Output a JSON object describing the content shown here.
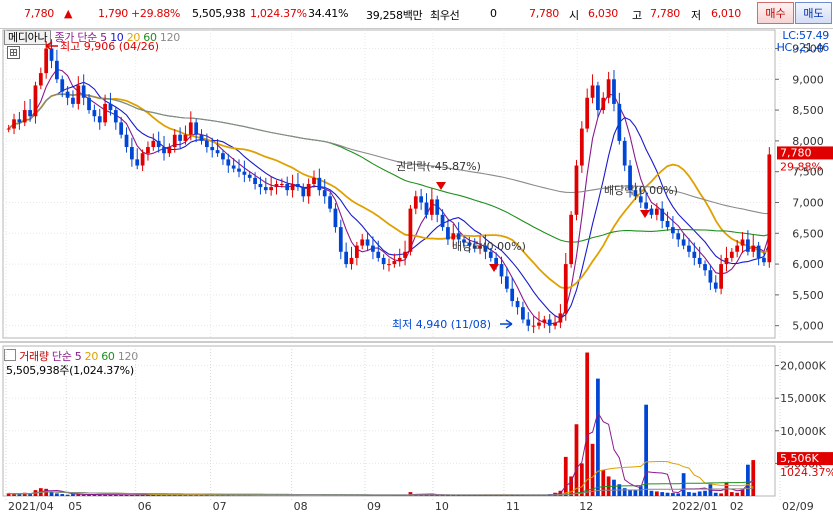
{
  "quote_bar": {
    "price": "7,780",
    "change": "1,790",
    "change_pct": "+29.88%",
    "volume": "5,505,938",
    "volume_ratio": "1,024.37%",
    "turnover": "34.41%",
    "amount": "39,258백만",
    "best_bid_label": "최우선",
    "best_bid_qty": "0",
    "best_price": "7,780",
    "open_label": "시",
    "open": "6,030",
    "high_label": "고",
    "high": "7,780",
    "low_label": "저",
    "low": "6,010",
    "buy_label": "매수",
    "sell_label": "매도"
  },
  "price_panel": {
    "stock_name": "메디아나",
    "indicator_label": "종가 단순",
    "ma_periods": [
      "5",
      "10",
      "20",
      "60",
      "120"
    ],
    "lc": "LC:57.49",
    "hc": "HC:-21.46",
    "current_price_tag": "7,780",
    "current_pct_tag": "29.88%",
    "annotations": {
      "high": "최고 9,906 (04/26)",
      "low": "최저 4,940 (11/08)",
      "rights": "권리락(-45.87%)",
      "div1": "배당락(0.00%)",
      "div2": "배당락(0.00%)"
    }
  },
  "volume_panel": {
    "label": "거래량",
    "indicator_label": "단순",
    "ma_periods": [
      "5",
      "20",
      "60",
      "120"
    ],
    "value_line": "5,505,938주(1,024.37%)",
    "vol_tag": "5,506K",
    "vol_pct_tag": "1024.37%"
  },
  "colors": {
    "up": "#e00000",
    "down": "#0046d5",
    "ma5": "#8b1a8b",
    "ma10": "#1a1acc",
    "ma20": "#e0a000",
    "ma60": "#1f8f1f",
    "ma120": "#8a8a8a"
  },
  "chart_data": {
    "type": "candlestick",
    "price_axis_ticks": [
      "9,500",
      "9,000",
      "8,500",
      "8,000",
      "7,500",
      "7,000",
      "6,500",
      "6,000",
      "5,500",
      "5,000"
    ],
    "volume_axis_ticks": [
      "20,000K",
      "15,000K",
      "10,000K",
      "5,000K"
    ],
    "x_tick_labels": [
      "2021/04",
      "05",
      "06",
      "07",
      "08",
      "09",
      "10",
      "11",
      "12",
      "2022/01",
      "02",
      "02/09"
    ],
    "price_ylim": [
      4800,
      9800
    ],
    "volume_ylim": [
      0,
      23000
    ],
    "close_series": [
      8200,
      8350,
      8300,
      8500,
      8400,
      8900,
      9100,
      9500,
      9300,
      9000,
      8800,
      8700,
      8600,
      8900,
      8700,
      8500,
      8400,
      8300,
      8600,
      8500,
      8300,
      8100,
      7900,
      7700,
      7600,
      7800,
      7900,
      8000,
      7900,
      7800,
      7900,
      8100,
      8000,
      8100,
      8300,
      8100,
      8000,
      7900,
      7850,
      7800,
      7700,
      7600,
      7550,
      7500,
      7450,
      7400,
      7300,
      7250,
      7200,
      7250,
      7300,
      7300,
      7200,
      7300,
      7250,
      7100,
      7300,
      7400,
      7200,
      7100,
      6900,
      6600,
      6200,
      6000,
      6100,
      6300,
      6400,
      6300,
      6200,
      6100,
      6000,
      6000,
      6050,
      6100,
      6200,
      6900,
      7100,
      7000,
      6800,
      7050,
      6800,
      6600,
      6400,
      6500,
      6400,
      6350,
      6300,
      6250,
      6300,
      6200,
      6100,
      6000,
      5800,
      5600,
      5400,
      5300,
      5100,
      5000,
      5000,
      5050,
      5100,
      5000,
      5050,
      5200,
      6000,
      6800,
      7600,
      8200,
      8700,
      8900,
      8500,
      8700,
      9000,
      8600,
      8000,
      7600,
      7200,
      7100,
      7000,
      6900,
      6800,
      6900,
      6700,
      6600,
      6500,
      6400,
      6300,
      6200,
      6100,
      6000,
      5900,
      5700,
      5600,
      6000,
      6100,
      6200,
      6300,
      6400,
      6200,
      6300,
      6100,
      6030,
      7780
    ],
    "volume_series": [
      400,
      300,
      350,
      500,
      300,
      900,
      1200,
      1100,
      600,
      400,
      300,
      200,
      300,
      250,
      200,
      180,
      220,
      260,
      200,
      180,
      200,
      170,
      160,
      150,
      200,
      180,
      150,
      160,
      140,
      130,
      150,
      180,
      160,
      150,
      200,
      140,
      120,
      110,
      130,
      120,
      110,
      100,
      90,
      100,
      95,
      90,
      85,
      80,
      90,
      100,
      95,
      90,
      80,
      90,
      85,
      100,
      110,
      100,
      90,
      95,
      120,
      150,
      130,
      100,
      90,
      80,
      95,
      85,
      80,
      90,
      85,
      80,
      90,
      100,
      110,
      600,
      300,
      250,
      200,
      220,
      180,
      150,
      130,
      120,
      110,
      100,
      95,
      90,
      100,
      110,
      120,
      130,
      150,
      140,
      130,
      120,
      110,
      100,
      120,
      150,
      200,
      300,
      500,
      800,
      6000,
      3000,
      11000,
      5000,
      22000,
      8000,
      18000,
      4000,
      3000,
      2500,
      1800,
      1200,
      1000,
      900,
      1500,
      14000,
      800,
      700,
      600,
      500,
      450,
      400,
      3500,
      600,
      500,
      700,
      800,
      1800,
      500,
      400,
      2000,
      600,
      500,
      1000,
      4800,
      5506
    ]
  }
}
